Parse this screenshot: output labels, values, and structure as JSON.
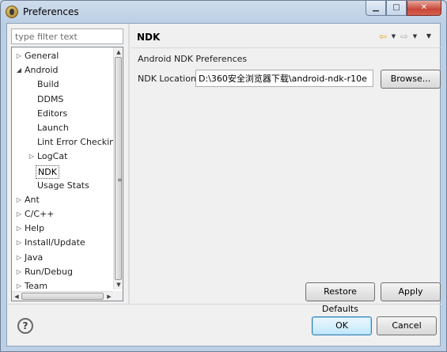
{
  "window": {
    "title": "Preferences",
    "minimize": "▁",
    "maximize": "□",
    "close": "✕"
  },
  "filter": {
    "placeholder": "type filter text"
  },
  "tree": [
    {
      "label": "General",
      "level": 0,
      "arrow": "▷"
    },
    {
      "label": "Android",
      "level": 0,
      "arrow": "◢"
    },
    {
      "label": "Build",
      "level": 1,
      "arrow": ""
    },
    {
      "label": "DDMS",
      "level": 1,
      "arrow": ""
    },
    {
      "label": "Editors",
      "level": 1,
      "arrow": ""
    },
    {
      "label": "Launch",
      "level": 1,
      "arrow": ""
    },
    {
      "label": "Lint Error Checking",
      "level": 1,
      "arrow": ""
    },
    {
      "label": "LogCat",
      "level": 1,
      "arrow": "▷"
    },
    {
      "label": "NDK",
      "level": 1,
      "arrow": "",
      "selected": true
    },
    {
      "label": "Usage Stats",
      "level": 1,
      "arrow": ""
    },
    {
      "label": "Ant",
      "level": 0,
      "arrow": "▷"
    },
    {
      "label": "C/C++",
      "level": 0,
      "arrow": "▷"
    },
    {
      "label": "Help",
      "level": 0,
      "arrow": "▷"
    },
    {
      "label": "Install/Update",
      "level": 0,
      "arrow": "▷"
    },
    {
      "label": "Java",
      "level": 0,
      "arrow": "▷"
    },
    {
      "label": "Run/Debug",
      "level": 0,
      "arrow": "▷"
    },
    {
      "label": "Team",
      "level": 0,
      "arrow": "▷"
    }
  ],
  "page": {
    "title": "NDK",
    "section": "Android NDK Preferences",
    "ndk_location_label": "NDK Location",
    "ndk_location_value": "D:\\360安全浏览器下载\\android-ndk-r10e",
    "browse_label": "Browse...",
    "restore_defaults_label": "Restore Defaults",
    "apply_label": "Apply"
  },
  "footer": {
    "help": "?",
    "ok_label": "OK",
    "cancel_label": "Cancel"
  }
}
